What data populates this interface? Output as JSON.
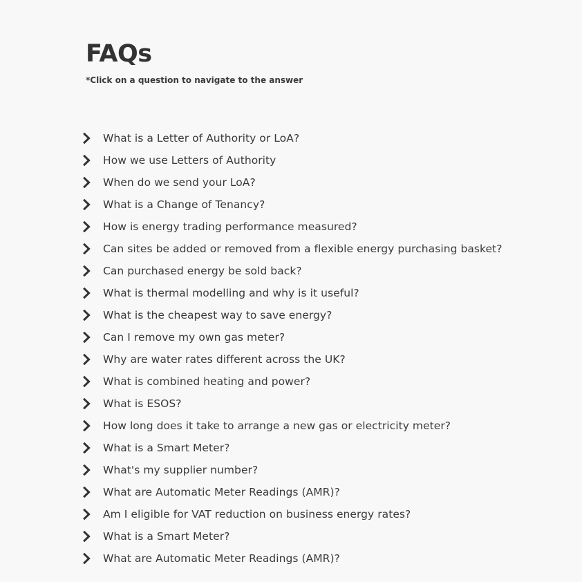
{
  "header": {
    "title": "FAQs",
    "subtitle": "*Click on a question to navigate to the answer"
  },
  "faq": {
    "items": [
      {
        "label": "What is a Letter of Authority or LoA?",
        "icon": "chevron-right-icon"
      },
      {
        "label": "How we use Letters of Authority",
        "icon": "chevron-right-icon"
      },
      {
        "label": "When do we send your LoA?",
        "icon": "chevron-right-icon"
      },
      {
        "label": "What is a Change of Tenancy?",
        "icon": "chevron-right-icon"
      },
      {
        "label": "How is energy trading performance measured?",
        "icon": "chevron-right-icon"
      },
      {
        "label": "Can sites be added or removed from a flexible energy purchasing basket?",
        "icon": "chevron-right-icon"
      },
      {
        "label": "Can purchased energy be sold back?",
        "icon": "chevron-right-icon"
      },
      {
        "label": "What is thermal modelling and why is it useful?",
        "icon": "chevron-right-icon"
      },
      {
        "label": "What is the cheapest way to save energy?",
        "icon": "chevron-right-icon"
      },
      {
        "label": "Can I remove my own gas meter?",
        "icon": "chevron-right-icon"
      },
      {
        "label": "Why are water rates different across the UK?",
        "icon": "chevron-right-icon"
      },
      {
        "label": "What is combined heating and power?",
        "icon": "chevron-right-icon"
      },
      {
        "label": "What is ESOS?",
        "icon": "chevron-right-icon"
      },
      {
        "label": "How long does it take to arrange a new gas or electricity meter?",
        "icon": "chevron-right-icon"
      },
      {
        "label": "What is a Smart Meter?",
        "icon": "chevron-right-icon"
      },
      {
        "label": "What's my supplier number?",
        "icon": "chevron-right-icon"
      },
      {
        "label": "What are Automatic Meter Readings (AMR)?",
        "icon": "chevron-right-icon"
      },
      {
        "label": "Am I eligible for VAT reduction on business energy rates?",
        "icon": "chevron-right-icon"
      },
      {
        "label": "What is a Smart Meter?",
        "icon": "chevron-right-icon"
      },
      {
        "label": "What are Automatic Meter Readings (AMR)?",
        "icon": "chevron-right-icon"
      }
    ]
  },
  "colors": {
    "background": "#f8f8f8",
    "text": "#3a3a3a",
    "title": "#333333",
    "chevron": "#333333"
  }
}
